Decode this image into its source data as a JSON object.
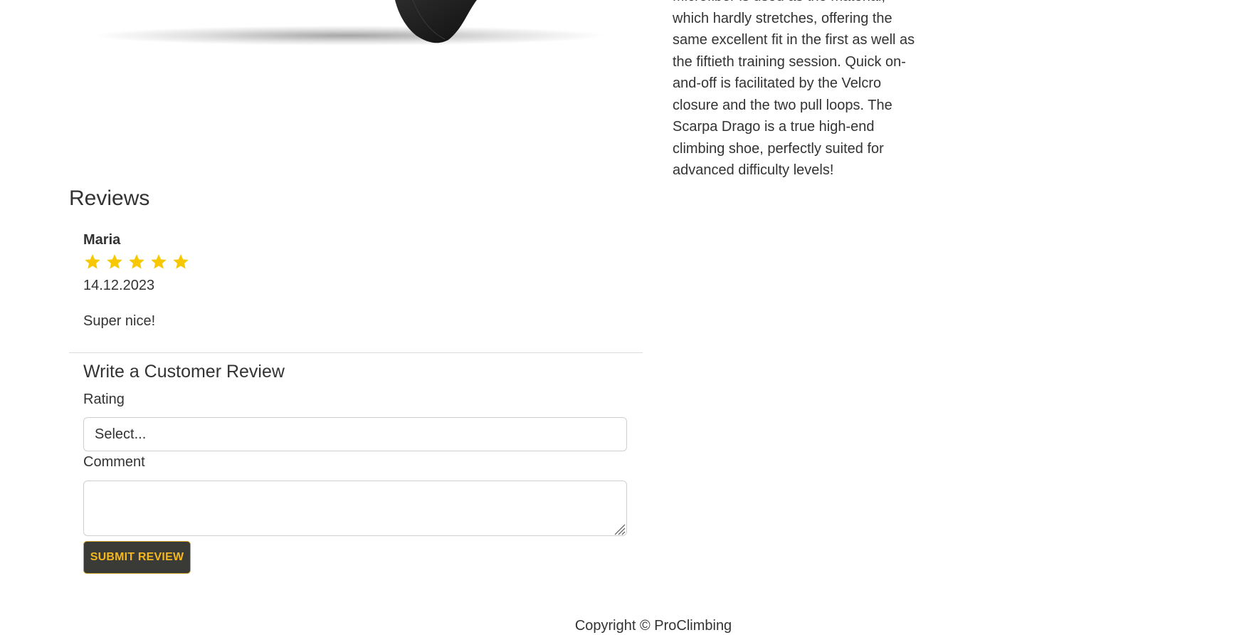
{
  "product": {
    "description_lines": [
      "Microfiber is used as the material,",
      "which hardly stretches, offering the",
      "same excellent fit in the first as well as",
      "the fiftieth training session. Quick on-",
      "and-off is facilitated by the Velcro",
      "closure and the two pull loops. The",
      "Scarpa Drago is a true high-end",
      "climbing shoe, perfectly suited for",
      "advanced difficulty levels!"
    ]
  },
  "reviews": {
    "title": "Reviews",
    "items": [
      {
        "author": "Maria",
        "rating": 5,
        "max_rating": 5,
        "date": "14.12.2023",
        "text": "Super nice!"
      }
    ]
  },
  "review_form": {
    "title": "Write a Customer Review",
    "rating_label": "Rating",
    "rating_value": "Select...",
    "comment_label": "Comment",
    "comment_value": "",
    "submit_label": "SUBMIT REVIEW"
  },
  "footer": {
    "copyright": "Copyright © ProClimbing"
  },
  "colors": {
    "star": "#f7c800",
    "button_bg": "#3a3a37",
    "button_text": "#f4b81e",
    "text": "#333333"
  },
  "icons": {
    "star": "star-icon",
    "resize": "resize-grip-icon"
  }
}
